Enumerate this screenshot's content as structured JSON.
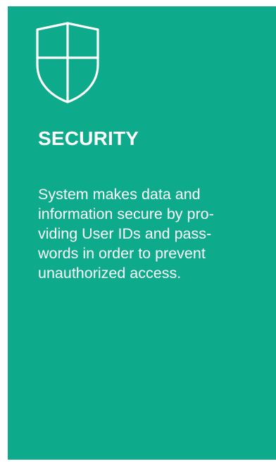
{
  "card": {
    "icon": "shield-icon",
    "title": "SECURITY",
    "description_lines": [
      "System makes data and",
      "information secure by pro-",
      "viding User IDs and pass-",
      "words in order to prevent",
      "unauthorized access."
    ]
  },
  "colors": {
    "card_background": "#0daa8c",
    "text": "#ffffff"
  }
}
